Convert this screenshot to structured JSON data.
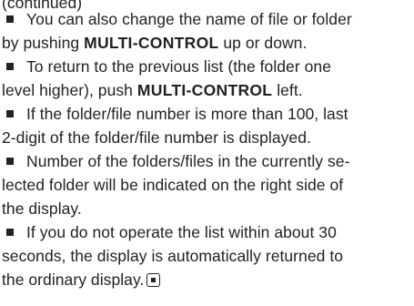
{
  "partial_top_line": "(continued)",
  "items": [
    {
      "lines": [
        {
          "before": "You can also change the name of file or folder",
          "bold": "",
          "after": ""
        },
        {
          "before": "by pushing ",
          "bold": "MULTI-CONTROL",
          "after": " up or down."
        }
      ]
    },
    {
      "lines": [
        {
          "before": "To return to the previous list (the folder one",
          "bold": "",
          "after": ""
        },
        {
          "before": "level higher), push ",
          "bold": "MULTI-CONTROL",
          "after": " left."
        }
      ]
    },
    {
      "lines": [
        {
          "before": "If the folder/file number is more than 100, last",
          "bold": "",
          "after": ""
        },
        {
          "before": "2-digit of the folder/file number is displayed.",
          "bold": "",
          "after": ""
        }
      ]
    },
    {
      "lines": [
        {
          "before": "Number of the folders/files in the currently se-",
          "bold": "",
          "after": ""
        },
        {
          "before": "lected folder will be indicated on the right side of",
          "bold": "",
          "after": ""
        },
        {
          "before": "the display.",
          "bold": "",
          "after": ""
        }
      ]
    },
    {
      "lines": [
        {
          "before": "If you do not operate the list within about 30",
          "bold": "",
          "after": ""
        },
        {
          "before": "seconds, the display is automatically returned to",
          "bold": "",
          "after": ""
        },
        {
          "before": "the ordinary display.",
          "bold": "",
          "after": ""
        }
      ]
    }
  ],
  "icons": {
    "bullet": "square-bullet-icon",
    "end_mark": "end-of-section-icon"
  },
  "colors": {
    "text": "#222222",
    "background": "#ffffff"
  }
}
